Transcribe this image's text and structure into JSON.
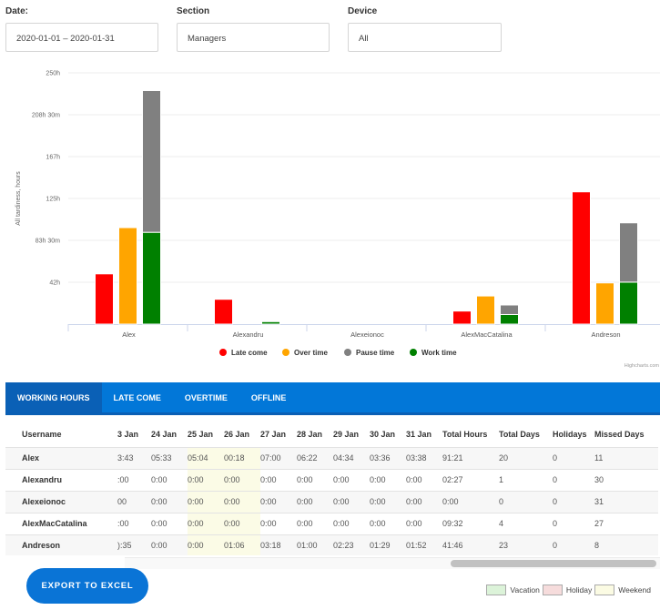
{
  "filters": {
    "date": {
      "label": "Date:",
      "value": "2020-01-01 – 2020-01-31"
    },
    "section": {
      "label": "Section",
      "value": "Managers"
    },
    "device": {
      "label": "Device",
      "value": "All"
    }
  },
  "chart_data": {
    "type": "bar",
    "title": "",
    "xlabel": "",
    "ylabel": "All tardiness, hours",
    "ylim": [
      0,
      250
    ],
    "yticks": [
      {
        "value": 0,
        "label": ""
      },
      {
        "value": 41.67,
        "label": "42h"
      },
      {
        "value": 83.33,
        "label": "83h 30m"
      },
      {
        "value": 125,
        "label": "125h"
      },
      {
        "value": 166.67,
        "label": "167h"
      },
      {
        "value": 208.33,
        "label": "208h 30m"
      },
      {
        "value": 250,
        "label": "250h"
      }
    ],
    "grid": true,
    "legend_position": "bottom-center",
    "categories": [
      "Alex",
      "Alexandru",
      "Alexeionoc",
      "AlexMacCatalina",
      "Andreson"
    ],
    "series": [
      {
        "name": "Late come",
        "color": "#ff0000",
        "stack": "late",
        "values": [
          50,
          24.7,
          0,
          13,
          131.6
        ]
      },
      {
        "name": "Over time",
        "color": "#ffa500",
        "stack": "over",
        "values": [
          96,
          0,
          0,
          28,
          41
        ]
      },
      {
        "name": "Pause time",
        "color": "#808080",
        "stack": "work",
        "values": [
          141,
          0,
          0,
          9.5,
          59
        ]
      },
      {
        "name": "Work time",
        "color": "#008000",
        "stack": "work",
        "values": [
          91.35,
          2.45,
          0,
          9.53,
          41.77
        ]
      }
    ],
    "credits": "Highcharts.com"
  },
  "tabs": [
    {
      "label": "WORKING HOURS",
      "active": true
    },
    {
      "label": "LATE COME",
      "active": false
    },
    {
      "label": "OVERTIME",
      "active": false
    },
    {
      "label": "OFFLINE",
      "active": false
    }
  ],
  "table": {
    "headers": [
      "Username",
      "3 Jan",
      "24 Jan",
      "25 Jan",
      "26 Jan",
      "27 Jan",
      "28 Jan",
      "29 Jan",
      "30 Jan",
      "31 Jan",
      "Total Hours",
      "Total Days",
      "Holidays",
      "Missed Days"
    ],
    "rows": [
      [
        "Alex",
        "3:43",
        "05:33",
        "05:04",
        "00:18",
        "07:00",
        "06:22",
        "04:34",
        "03:36",
        "03:38",
        "91:21",
        "20",
        "0",
        "11"
      ],
      [
        "Alexandru",
        ":00",
        "0:00",
        "0:00",
        "0:00",
        "0:00",
        "0:00",
        "0:00",
        "0:00",
        "0:00",
        "02:27",
        "1",
        "0",
        "30"
      ],
      [
        "Alexeionoc",
        "00",
        "0:00",
        "0:00",
        "0:00",
        "0:00",
        "0:00",
        "0:00",
        "0:00",
        "0:00",
        "0:00",
        "0",
        "0",
        "31"
      ],
      [
        "AlexMacCatalina",
        ":00",
        "0:00",
        "0:00",
        "0:00",
        "0:00",
        "0:00",
        "0:00",
        "0:00",
        "0:00",
        "09:32",
        "4",
        "0",
        "27"
      ],
      [
        "Andreson",
        "):35",
        "0:00",
        "0:00",
        "01:06",
        "03:18",
        "01:00",
        "02:23",
        "01:29",
        "01:52",
        "41:46",
        "23",
        "0",
        "8"
      ]
    ],
    "weekend_columns": [
      "25 Jan",
      "26 Jan"
    ]
  },
  "export_button": "EXPORT TO EXCEL",
  "legend_boxes": [
    {
      "label": "Vacation",
      "color": "#dcf3d9"
    },
    {
      "label": "Holiday",
      "color": "#f6dcdc"
    },
    {
      "label": "Weekend",
      "color": "#fbfbe3"
    }
  ]
}
